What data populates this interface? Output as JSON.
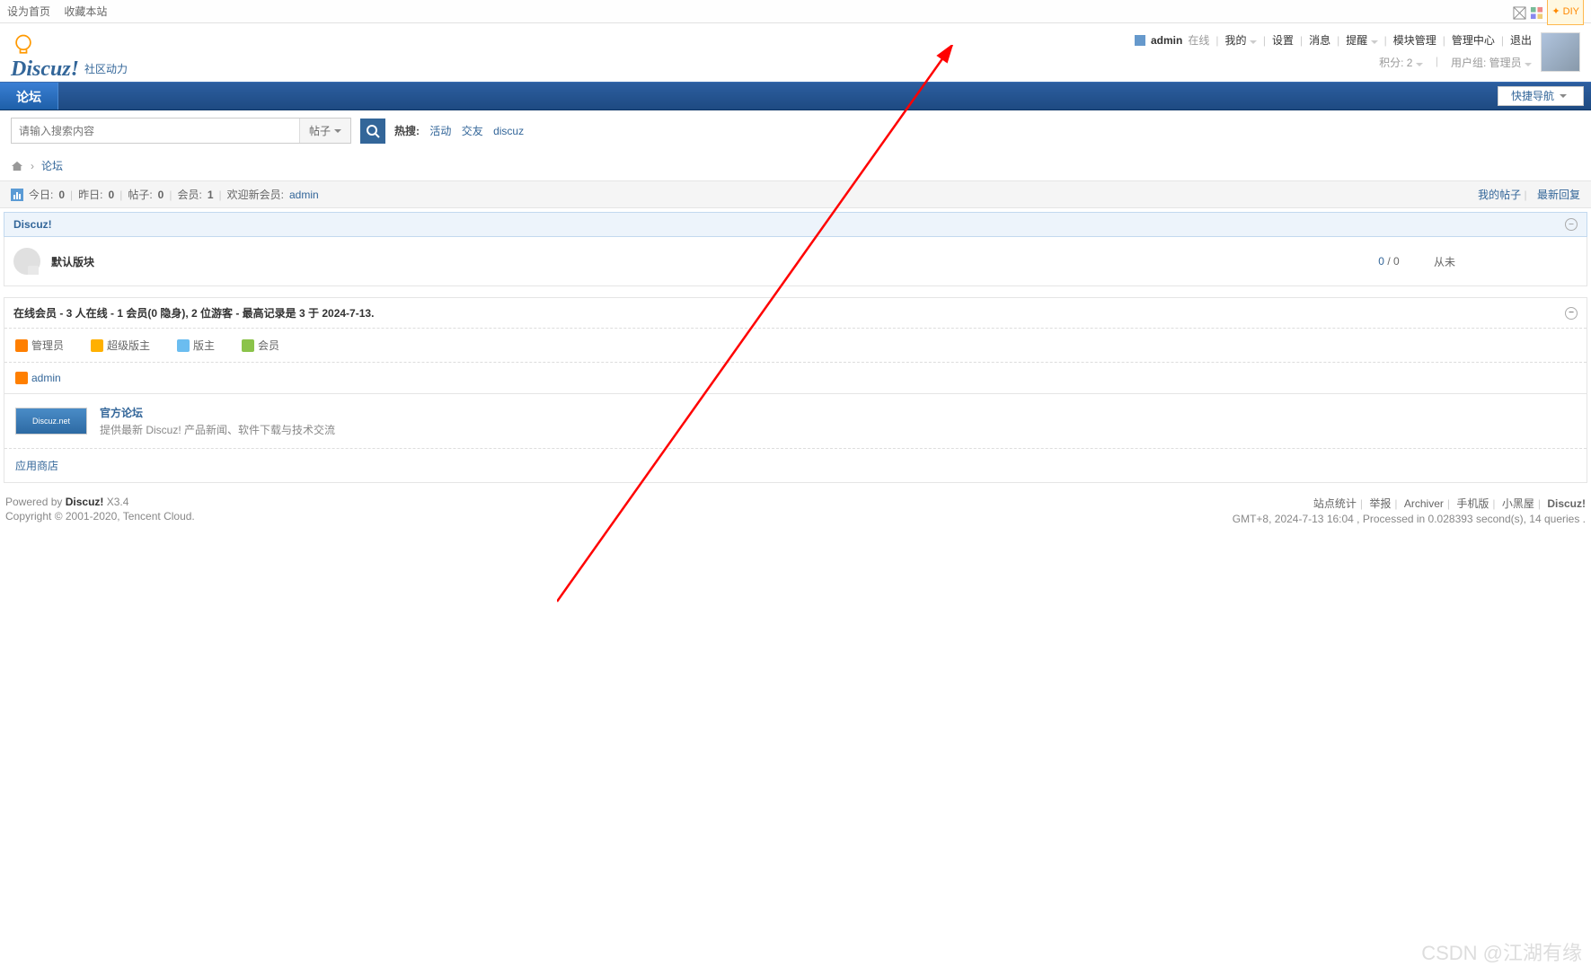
{
  "topbar": {
    "set_home": "设为首页",
    "favorite": "收藏本站",
    "diy": "DIY"
  },
  "logo": {
    "main": "Discuz!",
    "sub": "社区动力"
  },
  "user": {
    "name": "admin",
    "status": "在线",
    "mine": "我的",
    "settings": "设置",
    "messages": "消息",
    "reminders": "提醒",
    "module_mgmt": "模块管理",
    "admin_center": "管理中心",
    "logout": "退出",
    "points_label": "积分:",
    "points_val": "2",
    "group_label": "用户组:",
    "group_val": "管理员"
  },
  "nav": {
    "forum": "论坛",
    "quicknav": "快捷导航"
  },
  "search": {
    "placeholder": "请输入搜索内容",
    "type": "帖子",
    "hot_label": "热搜:",
    "hot": [
      "活动",
      "交友",
      "discuz"
    ]
  },
  "crumb": {
    "forum": "论坛"
  },
  "stats": {
    "today_l": "今日:",
    "today_v": "0",
    "yesterday_l": "昨日:",
    "yesterday_v": "0",
    "posts_l": "帖子:",
    "posts_v": "0",
    "members_l": "会员:",
    "members_v": "1",
    "welcome_l": "欢迎新会员:",
    "welcome_v": "admin",
    "my_posts": "我的帖子",
    "latest": "最新回复"
  },
  "category": {
    "name": "Discuz!"
  },
  "forum": {
    "name": "默认版块",
    "threads": "0",
    "posts": "0",
    "last": "从未"
  },
  "online": {
    "header": "在线会员 - 3 人在线 - 1 会员(0 隐身), 2 位游客 - 最高记录是 3 于 2024-7-13.",
    "legend": {
      "admin": "管理员",
      "supermod": "超级版主",
      "mod": "版主",
      "member": "会员"
    },
    "user1": "admin"
  },
  "links": {
    "official_t": "官方论坛",
    "official_d": "提供最新 Discuz! 产品新闻、软件下载与技术交流",
    "app_store": "应用商店",
    "badge": "Discuz.net"
  },
  "footer": {
    "powered": "Powered by",
    "brand": "Discuz!",
    "ver": "X3.4",
    "copyright": "Copyright © 2001-2020, Tencent Cloud.",
    "links": [
      "站点统计",
      "举报",
      "Archiver",
      "手机版",
      "小黑屋",
      "Discuz!"
    ],
    "time": "GMT+8, 2024-7-13 16:04 , Processed in 0.028393 second(s), 14 queries ."
  },
  "watermark": "CSDN @江湖有缘"
}
